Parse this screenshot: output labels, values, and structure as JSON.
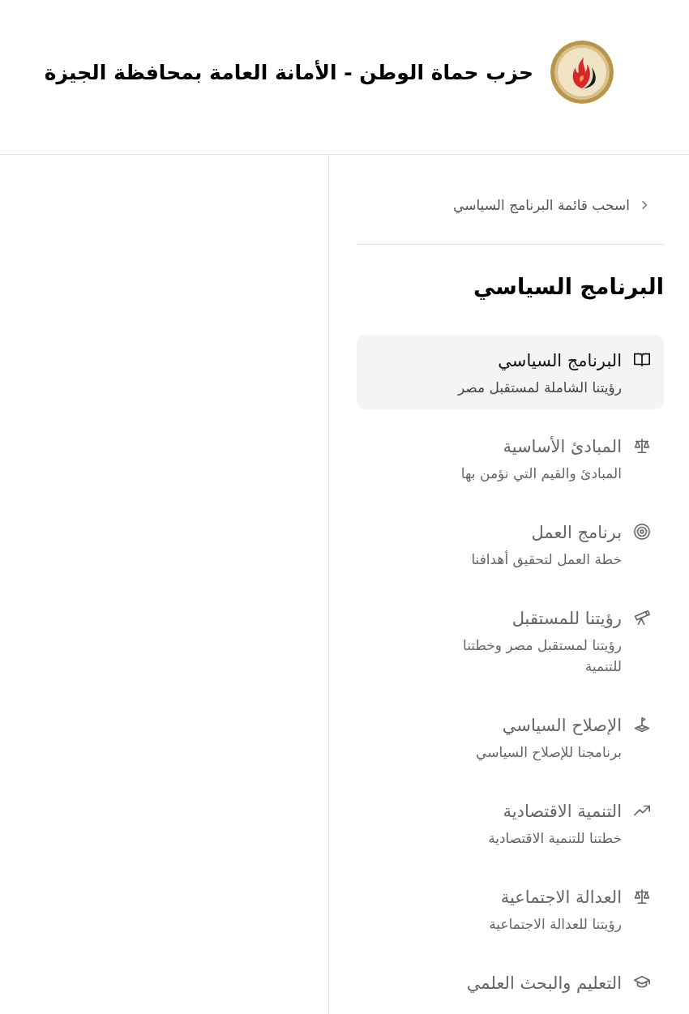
{
  "header": {
    "title": "حزب حماة الوطن - الأمانة العامة بمحافظة الجيزة"
  },
  "sidebar": {
    "collapse_link": "اسحب قائمة البرنامج السياسي",
    "heading": "البرنامج السياسي",
    "items": [
      {
        "kind": "book",
        "title": "البرنامج السياسي",
        "subtitle": "رؤيتنا الشاملة لمستقبل مصر",
        "selected": true
      },
      {
        "kind": "scale",
        "title": "المبادئ الأساسية",
        "subtitle": "المبادئ والقيم التي نؤمن بها",
        "selected": false
      },
      {
        "kind": "target",
        "title": "برنامج العمل",
        "subtitle": "خطة العمل لتحقيق أهدافنا",
        "selected": false
      },
      {
        "kind": "telescope",
        "title": "رؤيتنا للمستقبل",
        "subtitle": "رؤيتنا لمستقبل مصر وخطتنا للتنمية",
        "selected": false
      },
      {
        "kind": "waypoint",
        "title": "الإصلاح السياسي",
        "subtitle": "برنامجنا للإصلاح السياسي",
        "selected": false
      },
      {
        "kind": "trend",
        "title": "التنمية الاقتصادية",
        "subtitle": "خطتنا للتنمية الاقتصادية",
        "selected": false
      },
      {
        "kind": "scale",
        "title": "العدالة الاجتماعية",
        "subtitle": "رؤيتنا للعدالة الاجتماعية",
        "selected": false
      },
      {
        "kind": "cap",
        "title": "التعليم والبحث العلمي",
        "selected": false
      }
    ]
  }
}
